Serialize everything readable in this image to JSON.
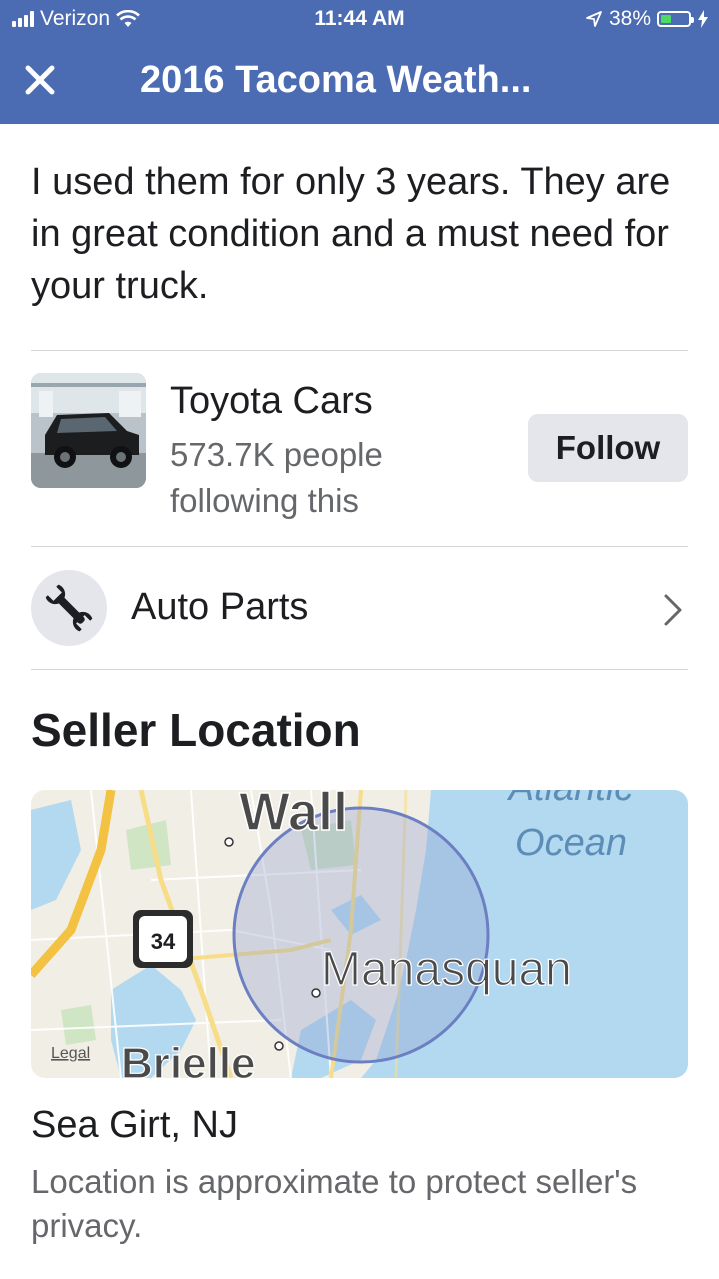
{
  "status_bar": {
    "carrier": "Verizon",
    "time": "11:44 AM",
    "battery_percent": "38%",
    "battery_level": 0.38,
    "signal_icon": "signal-bars-icon",
    "wifi_icon": "wifi-icon",
    "location_icon": "location-arrow-icon",
    "charging_icon": "charging-bolt-icon"
  },
  "nav": {
    "close_icon": "close-icon",
    "title": "2016 Tacoma Weath..."
  },
  "listing": {
    "description": "I used them for only 3 years. They are in great condition and a must need for your truck."
  },
  "page": {
    "name": "Toyota Cars",
    "followers": "573.7K people following this",
    "follow_label": "Follow"
  },
  "category": {
    "icon": "wrench-icon",
    "label": "Auto Parts"
  },
  "seller_location": {
    "heading": "Seller Location",
    "map": {
      "labels": {
        "wall": "Wall",
        "ocean": "Atlantic Ocean",
        "manasquan": "Manasquan",
        "brielle": "Brielle",
        "legal": "Legal",
        "route_shield": "34"
      }
    },
    "city": "Sea Girt, NJ",
    "note": "Location is approximate to protect seller's privacy."
  },
  "colors": {
    "header_blue": "#4b6bb3",
    "battery_green": "#4cd964",
    "button_grey": "#e4e6eb",
    "secondary_text": "#65676b",
    "map_water": "#b3d9f0"
  }
}
